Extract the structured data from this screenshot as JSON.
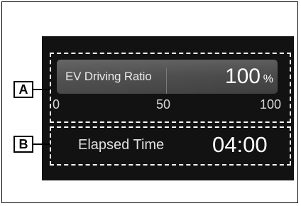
{
  "callouts": {
    "a": "A",
    "b": "B"
  },
  "ev_ratio": {
    "label": "EV Driving Ratio",
    "value": "100",
    "unit": "%",
    "fill_fraction": 1.0,
    "scale": [
      "0",
      "50",
      "100"
    ]
  },
  "elapsed": {
    "label": "Elapsed Time",
    "value": "04:00"
  }
}
